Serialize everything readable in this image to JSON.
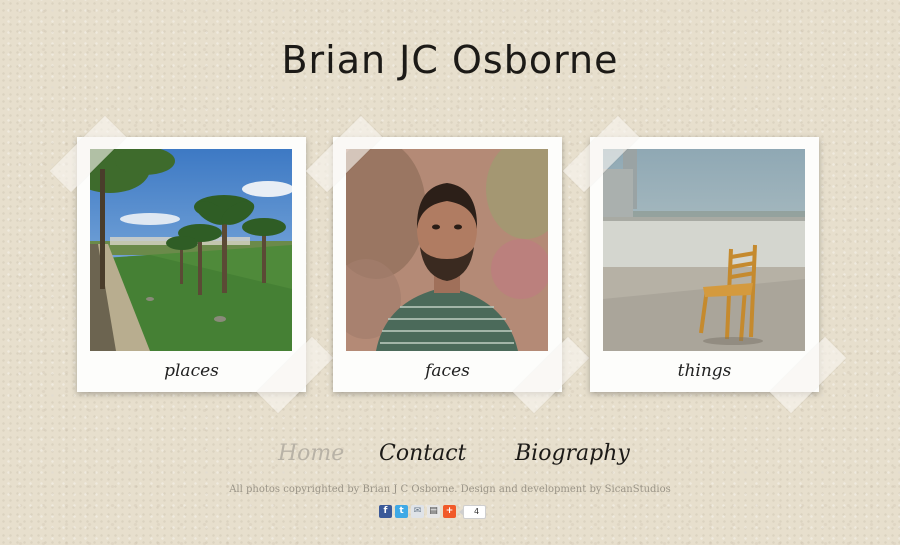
{
  "site": {
    "title": "Brian JC Osborne"
  },
  "gallery": {
    "items": [
      {
        "caption": "places",
        "photo": "palm-trees-park-photo"
      },
      {
        "caption": "faces",
        "photo": "bearded-man-portrait-photo"
      },
      {
        "caption": "things",
        "photo": "wooden-chair-rooftop-photo"
      }
    ]
  },
  "nav": {
    "items": [
      {
        "label": "Home",
        "current": true
      },
      {
        "label": "Contact",
        "current": false
      },
      {
        "label": "Biography",
        "current": false
      }
    ]
  },
  "footer": {
    "text": "All photos copyrighted by  Brian J C Osborne. Design and development by SicanStudios"
  },
  "share": {
    "icons": [
      "facebook-icon",
      "twitter-icon",
      "email-icon",
      "print-icon",
      "addthis-icon"
    ],
    "count": "4"
  },
  "colors": {
    "background": "#e7dfcd",
    "text": "#1c1a17",
    "nav_current": "#b8b2a6",
    "footer_text": "#9a9487",
    "facebook": "#3b5998",
    "twitter": "#3fa9e6",
    "addthis": "#f15a29"
  }
}
